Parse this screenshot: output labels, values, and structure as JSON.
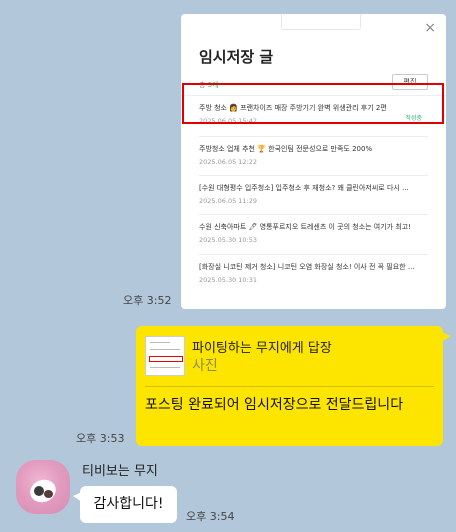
{
  "screenshot": {
    "close_symbol": "×",
    "title": "임시저장 글",
    "count_label": "총",
    "count_value": "5개",
    "edit_label": "편집",
    "drafts": [
      {
        "title": "주방 청소 👩 프랜차이즈 매장 주방기기 완벽 위생관리 후기 2편",
        "date": "2025.06.05 15:42",
        "badge": "작성중"
      },
      {
        "title": "주방청소 업체 추천 🏆 한국인팀 전문성으로 만족도 200%",
        "date": "2025.06.05 12:22",
        "badge": ""
      },
      {
        "title": "[수원 대형평수 입주청소] 입주청소 후 재청소? 왜 클린아저씨로 다시 ...",
        "date": "2025.06.05 11:29",
        "badge": ""
      },
      {
        "title": "수원 신축아파트 🖊 영통푸르지오 트레센츠 이 곳의 청소는 여기가 최고!",
        "date": "2025.05.30 10:53",
        "badge": ""
      },
      {
        "title": "[화장실 니코틴 제거 청소] 니코틴 오염 화장실 청소! 이사 전 꼭 필요한 ...",
        "date": "2025.05.30 10:31",
        "badge": ""
      }
    ]
  },
  "messages": {
    "time_image": "오후 3:52",
    "reply": {
      "to": "파이팅하는 무지에게 답장",
      "kind": "사진",
      "text": "포스팅 완료되어 임시저장으로 전달드립니다"
    },
    "time_reply": "오후 3:53",
    "other_sender": "티비보는 무지",
    "other_text": "감사합니다!",
    "time_other": "오후 3:54"
  },
  "colors": {
    "chat_background": "#b2c7da",
    "my_bubble": "#fee500",
    "highlight": "#e00000",
    "status_green": "#2eb872"
  }
}
